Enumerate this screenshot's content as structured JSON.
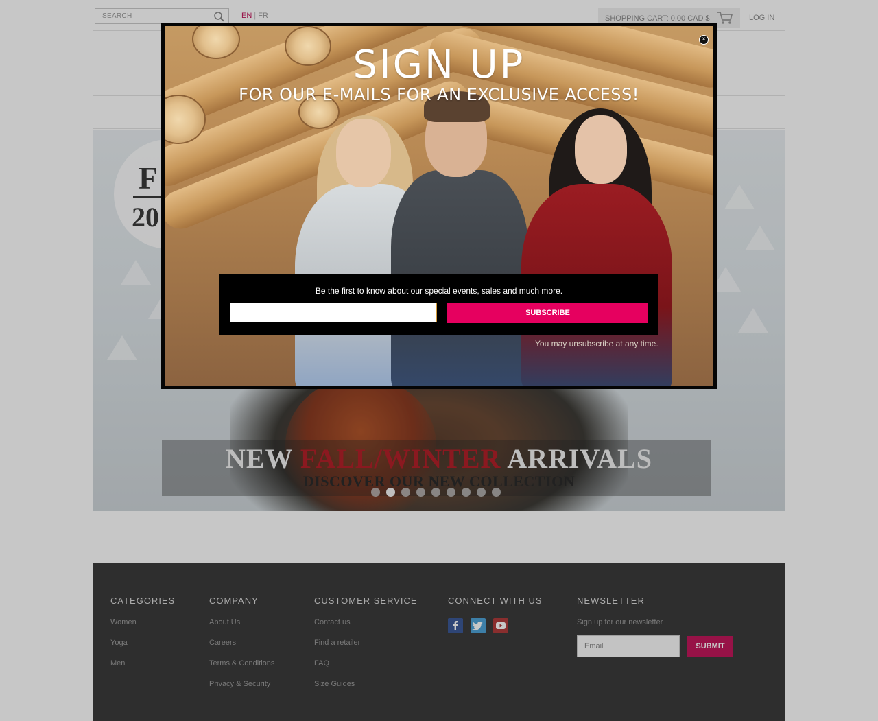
{
  "header": {
    "search_placeholder": "SEARCH",
    "lang_en": "EN",
    "lang_fr": "FR",
    "cart_text": "SHOPPING CART: 0.00 CAD $",
    "login": "LOG IN"
  },
  "hero": {
    "badge_top": "F",
    "badge_year": "20",
    "headline_new": "NEW",
    "headline_season": "FALL/WINTER",
    "headline_arrivals": "ARRIVALS",
    "subheadline": "DISCOVER OUR NEW COLLECTION",
    "slide_count": 9,
    "active_slide": 2
  },
  "modal": {
    "title": "SIGN UP",
    "subtitle": "FOR OUR E-MAILS FOR AN EXCLUSIVE ACCESS!",
    "message": "Be the first to know about our special events, sales and much more.",
    "email_value": "",
    "subscribe_label": "SUBSCRIBE",
    "unsubscribe_note": "You may unsubscribe at any time.",
    "close_glyph": "×"
  },
  "footer": {
    "categories": {
      "title": "CATEGORIES",
      "links": [
        "Women",
        "Yoga",
        "Men"
      ]
    },
    "company": {
      "title": "COMPANY",
      "links": [
        "About Us",
        "Careers",
        "Terms & Conditions",
        "Privacy & Security"
      ]
    },
    "customer_service": {
      "title": "CUSTOMER SERVICE",
      "links": [
        "Contact us",
        "Find a retailer",
        "FAQ",
        "Size Guides"
      ]
    },
    "connect": {
      "title": "CONNECT WITH US",
      "icons": [
        "facebook-icon",
        "twitter-icon",
        "youtube-icon"
      ]
    },
    "newsletter": {
      "title": "NEWSLETTER",
      "note": "Sign up for our newsletter",
      "placeholder": "Email",
      "submit": "SUBMIT"
    }
  },
  "colors": {
    "accent": "#e6005f",
    "footer_bg": "#3b3b3b",
    "footer_button": "#c2185b",
    "season_red": "#b3202a"
  }
}
